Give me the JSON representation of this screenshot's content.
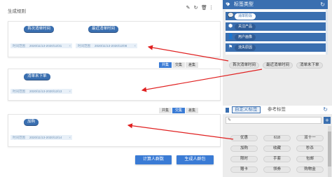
{
  "workspace": {
    "title": "生成规则",
    "tools": [
      "edit-icon",
      "refresh-icon",
      "delete-icon",
      "more-icon"
    ]
  },
  "cards": [
    {
      "chips": [
        "首次消单时间",
        "最近消单时间"
      ],
      "rows": [
        {
          "label": "时间范围",
          "value": "2020/11/13-2020/12/31"
        },
        {
          "label": "时间范围",
          "value": "2020/11/13-2020/12/08"
        }
      ],
      "seg": [
        "并集",
        "交集",
        "差集"
      ],
      "active": 0
    },
    {
      "chips": [
        "消单未下单"
      ],
      "rows": [
        {
          "label": "时间范围",
          "value": "2020/11/13-2020/12/13"
        }
      ],
      "seg": [
        "并集",
        "交集",
        "差集"
      ],
      "active": 1
    },
    {
      "chips": [
        "加购"
      ],
      "rows": [
        {
          "label": "时间范围",
          "value": "2020/11/13-2020/12/14"
        }
      ],
      "seg": [],
      "active": -1
    }
  ],
  "buttons": {
    "compute": "计算人群数",
    "generate": "生成人群包"
  },
  "panel": {
    "title": "标签类型",
    "categories": [
      {
        "icon": "chat-icon",
        "label": "消单阶段",
        "selected": true
      },
      {
        "icon": "cube-icon",
        "label": "关注产品",
        "selected": false
      },
      {
        "icon": "user-icon",
        "label": "用户画像",
        "selected": false
      },
      {
        "icon": "flag-icon",
        "label": "流失原因",
        "selected": false
      }
    ],
    "category_tags": [
      "首次消单时间",
      "最近消单时间",
      "消单未下单"
    ],
    "tabs": {
      "custom": "自定义标签",
      "reference": "参考标签"
    },
    "custom_tags": [
      "优惠",
      "618",
      "双十一",
      "加购",
      "收藏",
      "秒杀",
      "限时",
      "手套",
      "包邮",
      "赠卡",
      "领券",
      "购物金"
    ]
  },
  "colors": {
    "primary": "#3a7bd5",
    "panel_blue": "#3a6fb0",
    "arrow": "#e02020"
  }
}
